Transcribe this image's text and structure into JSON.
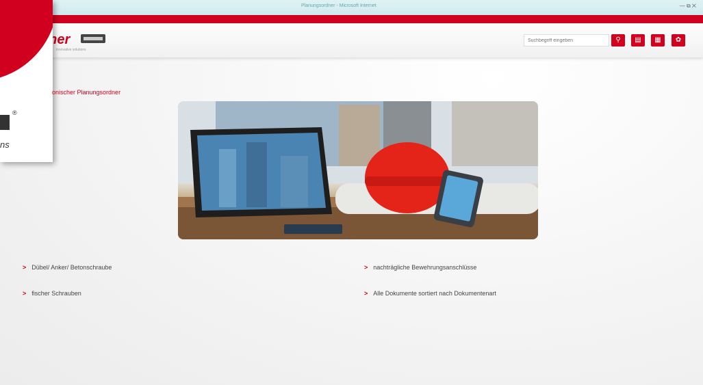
{
  "window": {
    "title": "Planungsordner - Microsoft Internet",
    "controls": "— ⧉ ✕"
  },
  "header": {
    "logo_text": "cher",
    "logo_sub": "innovative solutions",
    "search_placeholder": "Suchbegriff eingeben",
    "buttons": [
      {
        "icon": "search-icon",
        "glyph": "⚲"
      },
      {
        "icon": "book-icon",
        "glyph": "▤"
      },
      {
        "icon": "document-search-icon",
        "glyph": "▦"
      },
      {
        "icon": "gear-icon",
        "glyph": "✿"
      }
    ]
  },
  "overlay": {
    "ns_text": "ns",
    "reg": "®"
  },
  "page": {
    "title": "onischer Planungsordner"
  },
  "links": [
    {
      "label": "Dübel/ Anker/ Betonschraube"
    },
    {
      "label": "nachträgliche Bewehrungsanschlüsse"
    },
    {
      "label": "fischer Schrauben"
    },
    {
      "label": "Alle Dokumente sortiert nach Dokumentenart"
    }
  ],
  "colors": {
    "brand": "#d1001f",
    "helmet": "#e42418"
  }
}
